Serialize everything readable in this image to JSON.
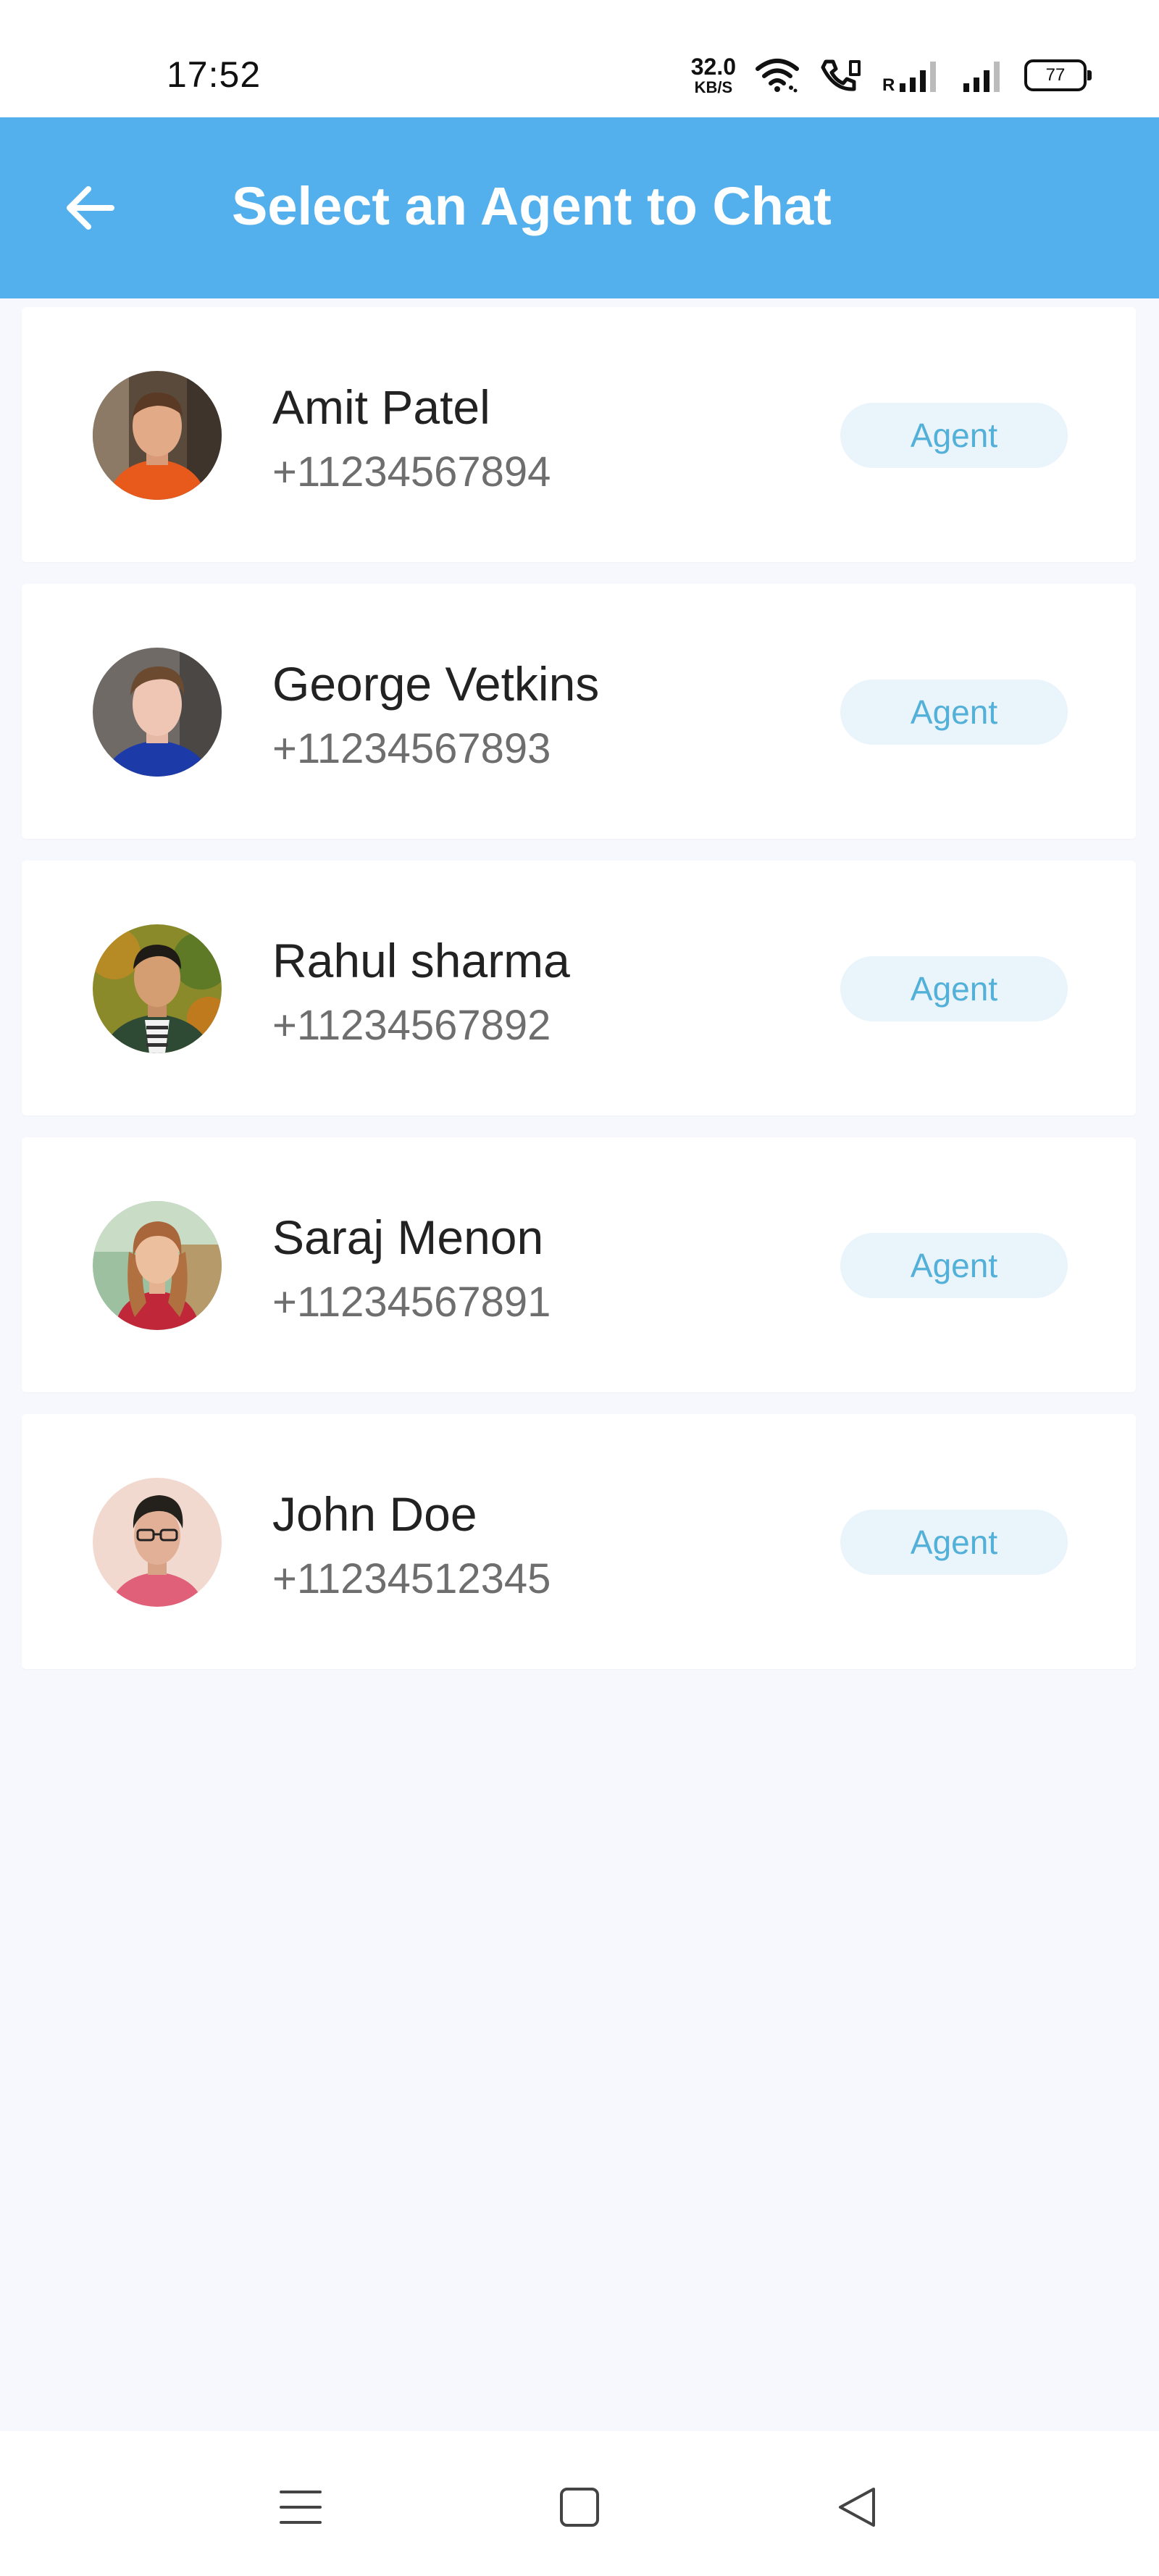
{
  "status_bar": {
    "time": "17:52",
    "net_speed_value": "32.0",
    "net_speed_unit": "KB/S",
    "signal_roaming_label": "R",
    "battery_level": "77",
    "icons": [
      "wifi-icon",
      "volte-call-icon",
      "signal-roaming-icon",
      "signal-icon",
      "battery-icon"
    ]
  },
  "app_bar": {
    "title": "Select an Agent to Chat",
    "back_icon": "arrow-left-icon"
  },
  "agents": [
    {
      "name": "Amit Patel",
      "phone": "+11234567894",
      "role": "Agent"
    },
    {
      "name": "George Vetkins",
      "phone": "+11234567893",
      "role": "Agent"
    },
    {
      "name": "Rahul sharma",
      "phone": "+11234567892",
      "role": "Agent"
    },
    {
      "name": "Saraj Menon",
      "phone": "+11234567891",
      "role": "Agent"
    },
    {
      "name": "John Doe",
      "phone": "+11234512345",
      "role": "Agent"
    }
  ],
  "nav_bar": {
    "icons": [
      "menu-icon",
      "home-square-icon",
      "back-triangle-icon"
    ]
  },
  "colors": {
    "primary": "#53b0ec",
    "background": "#f6f8fd",
    "badge_bg": "#eaf4fb",
    "badge_text": "#53b0d8"
  }
}
